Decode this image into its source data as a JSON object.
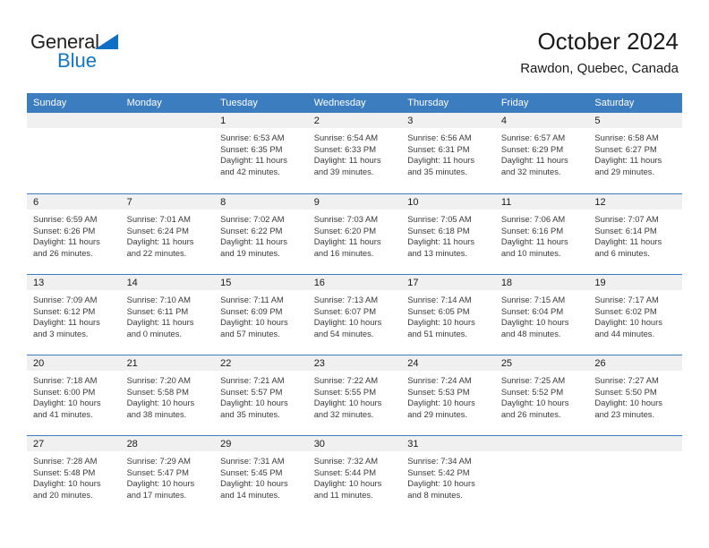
{
  "logo": {
    "line1": "General",
    "line2": "Blue",
    "triangle_color": "#0f6fc5",
    "blue_color": "#1277c4"
  },
  "header": {
    "title": "October 2024",
    "subtitle": "Rawdon, Quebec, Canada"
  },
  "theme": {
    "header_bg": "#3c7dc0",
    "daynum_bg": "#f0f0f0",
    "row_divider": "#3c7dc0"
  },
  "weekday_headers": [
    "Sunday",
    "Monday",
    "Tuesday",
    "Wednesday",
    "Thursday",
    "Friday",
    "Saturday"
  ],
  "weeks": [
    [
      {
        "day": "",
        "sunrise": "",
        "sunset": "",
        "daylight": ""
      },
      {
        "day": "",
        "sunrise": "",
        "sunset": "",
        "daylight": ""
      },
      {
        "day": "1",
        "sunrise": "Sunrise: 6:53 AM",
        "sunset": "Sunset: 6:35 PM",
        "daylight": "Daylight: 11 hours and 42 minutes."
      },
      {
        "day": "2",
        "sunrise": "Sunrise: 6:54 AM",
        "sunset": "Sunset: 6:33 PM",
        "daylight": "Daylight: 11 hours and 39 minutes."
      },
      {
        "day": "3",
        "sunrise": "Sunrise: 6:56 AM",
        "sunset": "Sunset: 6:31 PM",
        "daylight": "Daylight: 11 hours and 35 minutes."
      },
      {
        "day": "4",
        "sunrise": "Sunrise: 6:57 AM",
        "sunset": "Sunset: 6:29 PM",
        "daylight": "Daylight: 11 hours and 32 minutes."
      },
      {
        "day": "5",
        "sunrise": "Sunrise: 6:58 AM",
        "sunset": "Sunset: 6:27 PM",
        "daylight": "Daylight: 11 hours and 29 minutes."
      }
    ],
    [
      {
        "day": "6",
        "sunrise": "Sunrise: 6:59 AM",
        "sunset": "Sunset: 6:26 PM",
        "daylight": "Daylight: 11 hours and 26 minutes."
      },
      {
        "day": "7",
        "sunrise": "Sunrise: 7:01 AM",
        "sunset": "Sunset: 6:24 PM",
        "daylight": "Daylight: 11 hours and 22 minutes."
      },
      {
        "day": "8",
        "sunrise": "Sunrise: 7:02 AM",
        "sunset": "Sunset: 6:22 PM",
        "daylight": "Daylight: 11 hours and 19 minutes."
      },
      {
        "day": "9",
        "sunrise": "Sunrise: 7:03 AM",
        "sunset": "Sunset: 6:20 PM",
        "daylight": "Daylight: 11 hours and 16 minutes."
      },
      {
        "day": "10",
        "sunrise": "Sunrise: 7:05 AM",
        "sunset": "Sunset: 6:18 PM",
        "daylight": "Daylight: 11 hours and 13 minutes."
      },
      {
        "day": "11",
        "sunrise": "Sunrise: 7:06 AM",
        "sunset": "Sunset: 6:16 PM",
        "daylight": "Daylight: 11 hours and 10 minutes."
      },
      {
        "day": "12",
        "sunrise": "Sunrise: 7:07 AM",
        "sunset": "Sunset: 6:14 PM",
        "daylight": "Daylight: 11 hours and 6 minutes."
      }
    ],
    [
      {
        "day": "13",
        "sunrise": "Sunrise: 7:09 AM",
        "sunset": "Sunset: 6:12 PM",
        "daylight": "Daylight: 11 hours and 3 minutes."
      },
      {
        "day": "14",
        "sunrise": "Sunrise: 7:10 AM",
        "sunset": "Sunset: 6:11 PM",
        "daylight": "Daylight: 11 hours and 0 minutes."
      },
      {
        "day": "15",
        "sunrise": "Sunrise: 7:11 AM",
        "sunset": "Sunset: 6:09 PM",
        "daylight": "Daylight: 10 hours and 57 minutes."
      },
      {
        "day": "16",
        "sunrise": "Sunrise: 7:13 AM",
        "sunset": "Sunset: 6:07 PM",
        "daylight": "Daylight: 10 hours and 54 minutes."
      },
      {
        "day": "17",
        "sunrise": "Sunrise: 7:14 AM",
        "sunset": "Sunset: 6:05 PM",
        "daylight": "Daylight: 10 hours and 51 minutes."
      },
      {
        "day": "18",
        "sunrise": "Sunrise: 7:15 AM",
        "sunset": "Sunset: 6:04 PM",
        "daylight": "Daylight: 10 hours and 48 minutes."
      },
      {
        "day": "19",
        "sunrise": "Sunrise: 7:17 AM",
        "sunset": "Sunset: 6:02 PM",
        "daylight": "Daylight: 10 hours and 44 minutes."
      }
    ],
    [
      {
        "day": "20",
        "sunrise": "Sunrise: 7:18 AM",
        "sunset": "Sunset: 6:00 PM",
        "daylight": "Daylight: 10 hours and 41 minutes."
      },
      {
        "day": "21",
        "sunrise": "Sunrise: 7:20 AM",
        "sunset": "Sunset: 5:58 PM",
        "daylight": "Daylight: 10 hours and 38 minutes."
      },
      {
        "day": "22",
        "sunrise": "Sunrise: 7:21 AM",
        "sunset": "Sunset: 5:57 PM",
        "daylight": "Daylight: 10 hours and 35 minutes."
      },
      {
        "day": "23",
        "sunrise": "Sunrise: 7:22 AM",
        "sunset": "Sunset: 5:55 PM",
        "daylight": "Daylight: 10 hours and 32 minutes."
      },
      {
        "day": "24",
        "sunrise": "Sunrise: 7:24 AM",
        "sunset": "Sunset: 5:53 PM",
        "daylight": "Daylight: 10 hours and 29 minutes."
      },
      {
        "day": "25",
        "sunrise": "Sunrise: 7:25 AM",
        "sunset": "Sunset: 5:52 PM",
        "daylight": "Daylight: 10 hours and 26 minutes."
      },
      {
        "day": "26",
        "sunrise": "Sunrise: 7:27 AM",
        "sunset": "Sunset: 5:50 PM",
        "daylight": "Daylight: 10 hours and 23 minutes."
      }
    ],
    [
      {
        "day": "27",
        "sunrise": "Sunrise: 7:28 AM",
        "sunset": "Sunset: 5:48 PM",
        "daylight": "Daylight: 10 hours and 20 minutes."
      },
      {
        "day": "28",
        "sunrise": "Sunrise: 7:29 AM",
        "sunset": "Sunset: 5:47 PM",
        "daylight": "Daylight: 10 hours and 17 minutes."
      },
      {
        "day": "29",
        "sunrise": "Sunrise: 7:31 AM",
        "sunset": "Sunset: 5:45 PM",
        "daylight": "Daylight: 10 hours and 14 minutes."
      },
      {
        "day": "30",
        "sunrise": "Sunrise: 7:32 AM",
        "sunset": "Sunset: 5:44 PM",
        "daylight": "Daylight: 10 hours and 11 minutes."
      },
      {
        "day": "31",
        "sunrise": "Sunrise: 7:34 AM",
        "sunset": "Sunset: 5:42 PM",
        "daylight": "Daylight: 10 hours and 8 minutes."
      },
      {
        "day": "",
        "sunrise": "",
        "sunset": "",
        "daylight": ""
      },
      {
        "day": "",
        "sunrise": "",
        "sunset": "",
        "daylight": ""
      }
    ]
  ]
}
